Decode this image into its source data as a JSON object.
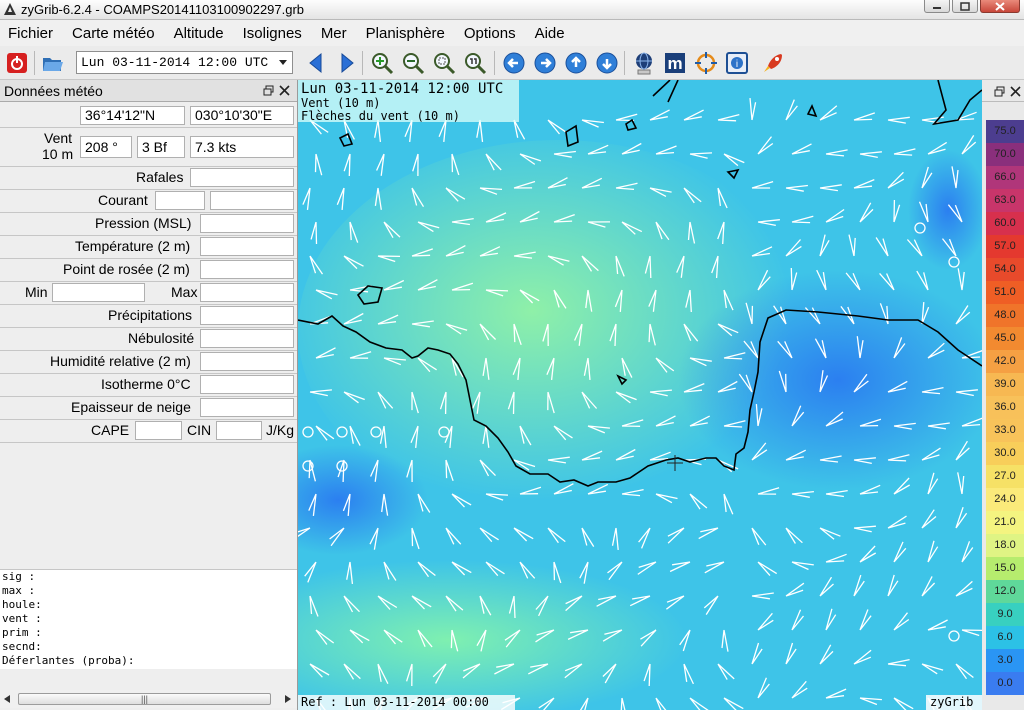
{
  "window": {
    "title": "zyGrib-6.2.4 - COAMPS20141103100902297.grb"
  },
  "menu": [
    "Fichier",
    "Carte météo",
    "Altitude",
    "Isolignes",
    "Mer",
    "Planisphère",
    "Options",
    "Aide"
  ],
  "toolbar": {
    "date_select": "Lun 03-11-2014 12:00 UTC",
    "icons": [
      "power-icon",
      "open-folder-icon",
      "prev-date-icon",
      "next-date-icon",
      "zoom-in-icon",
      "zoom-out-icon",
      "zoom-selection-icon",
      "zoom-all-icon",
      "pan-left-icon",
      "pan-right-icon",
      "pan-up-icon",
      "pan-down-icon",
      "globe-download-icon",
      "m-icon",
      "gps-icon",
      "map-info-icon",
      "rocket-icon"
    ]
  },
  "panel": {
    "title": "Données météo",
    "lat": "36°14'12\"N",
    "lon": "030°10'30\"E",
    "wind_label_1": "Vent",
    "wind_label_2": "10 m",
    "wind_dir": "208 °",
    "wind_bf": "3 Bf",
    "wind_kts": "7.3  kts",
    "rafales": "Rafales",
    "courant": "Courant",
    "pression": "Pression (MSL)",
    "temperature": "Température (2 m)",
    "rosee": "Point de rosée (2 m)",
    "min": "Min",
    "max": "Max",
    "precip": "Précipitations",
    "nebulosite": "Nébulosité",
    "humidite": "Humidité relative (2 m)",
    "isotherme": "Isotherme 0°C",
    "neige": "Epaisseur de neige",
    "cape": "CAPE",
    "cin": "CIN",
    "jkg": "J/Kg",
    "text_lines": [
      "sig  :",
      "max  :",
      "houle:",
      "vent :",
      "prim :",
      "secnd:",
      "Déferlantes (proba):"
    ]
  },
  "map": {
    "info_line1": "Lun 03-11-2014 12:00 UTC",
    "info_line2": "Vent (10 m)",
    "info_line3": "Flèches du vent (10 m)",
    "ref": "Ref : Lun 03-11-2014 00:00 UTC",
    "brand": "zyGrib"
  },
  "legend": {
    "values": [
      "75.0",
      "70.0",
      "66.0",
      "63.0",
      "60.0",
      "57.0",
      "54.0",
      "51.0",
      "48.0",
      "45.0",
      "42.0",
      "39.0",
      "36.0",
      "33.0",
      "30.0",
      "27.0",
      "24.0",
      "21.0",
      "18.0",
      "15.0",
      "12.0",
      "9.0",
      "6.0",
      "3.0",
      "0.0"
    ],
    "colors": [
      "#4c3d8f",
      "#8a2f7c",
      "#b0367a",
      "#c8356a",
      "#d7304d",
      "#e4392f",
      "#e84a2b",
      "#ef5e25",
      "#f0742a",
      "#f28a30",
      "#f5a043",
      "#f7b852",
      "#f8c15a",
      "#f8c35a",
      "#f8ce5a",
      "#f6e166",
      "#fbea7a",
      "#f4f480",
      "#dff484",
      "#b6ec6e",
      "#5fd89a",
      "#38d0c0",
      "#2cc1e6",
      "#2a95f4",
      "#3a7cf0"
    ]
  }
}
